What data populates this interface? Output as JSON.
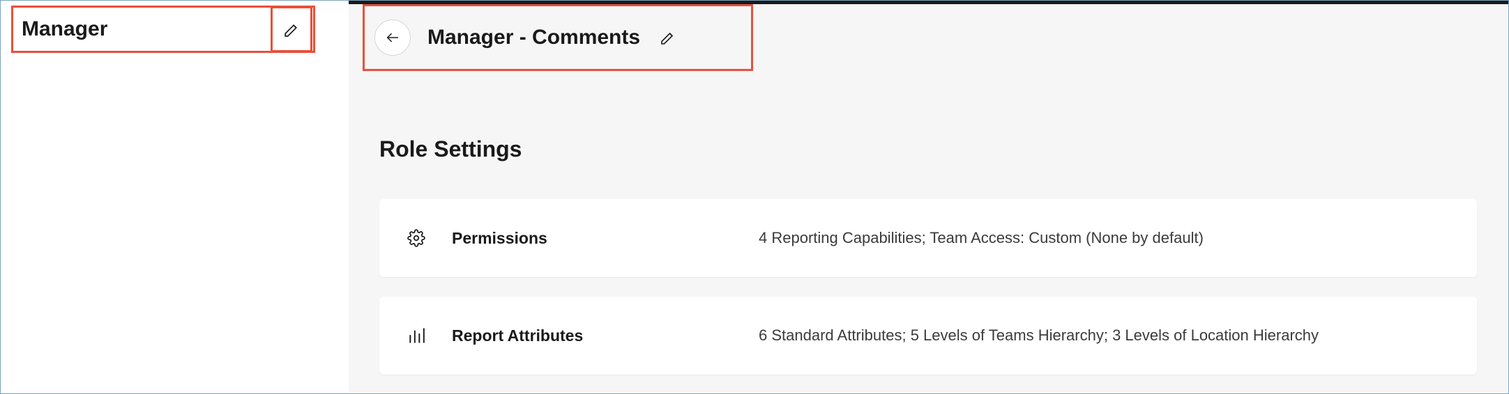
{
  "sidebar": {
    "selected_role_label": "Manager"
  },
  "header": {
    "title": "Manager - Comments"
  },
  "section": {
    "title": "Role Settings"
  },
  "cards": {
    "permissions": {
      "label": "Permissions",
      "summary": "4 Reporting Capabilities; Team Access: Custom (None by default)"
    },
    "report_attributes": {
      "label": "Report Attributes",
      "summary": "6 Standard Attributes; 5 Levels of Teams Hierarchy; 3 Levels of Location Hierarchy"
    }
  }
}
